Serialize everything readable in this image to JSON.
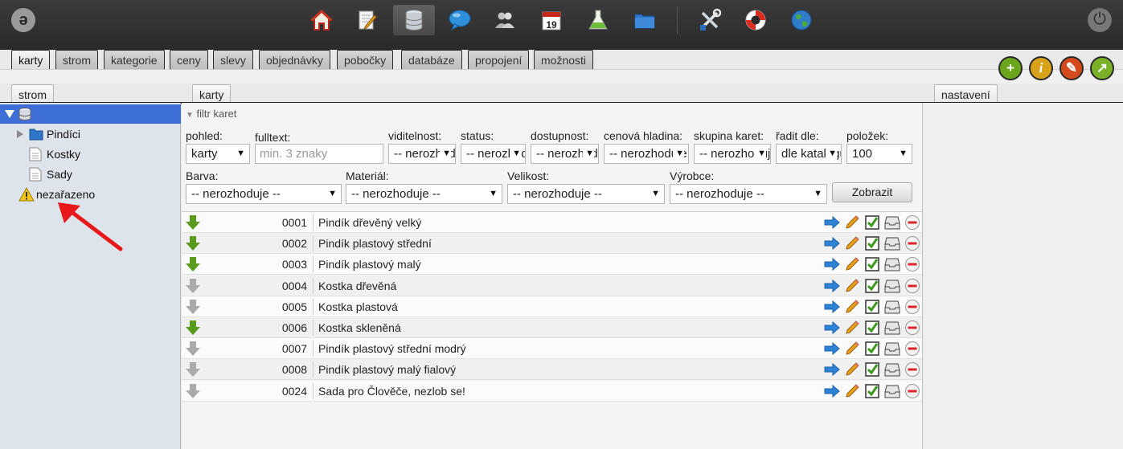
{
  "toolbar": {
    "logo_glyph": "ə",
    "icons": [
      "home-icon",
      "edit-document-icon",
      "database-icon",
      "chat-icon",
      "users-icon",
      "calendar-icon",
      "flask-icon",
      "folder-icon",
      "tools-icon",
      "lifebuoy-icon",
      "globe-icon"
    ],
    "calendar_day": "19",
    "active_icon": "database-icon"
  },
  "main_tabs": [
    "karty",
    "strom",
    "kategorie",
    "ceny",
    "slevy",
    "objednávky",
    "pobočky",
    "databáze",
    "propojení",
    "možnosti"
  ],
  "action_buttons": [
    {
      "name": "add-icon",
      "glyph": "+",
      "color": "#6aa51c"
    },
    {
      "name": "info-icon",
      "glyph": "i",
      "color": "#d9a21b"
    },
    {
      "name": "wrench-icon",
      "glyph": "✎",
      "color": "#d44a1c"
    },
    {
      "name": "export-icon",
      "glyph": "↗",
      "color": "#7bb028"
    }
  ],
  "panels": {
    "left_tab": "strom",
    "center_tab": "karty",
    "right_tab": "nastavení"
  },
  "tree": {
    "items": [
      {
        "label": "Pindíci",
        "type": "folder"
      },
      {
        "label": "Kostky",
        "type": "document"
      },
      {
        "label": "Sady",
        "type": "document"
      },
      {
        "label": "nezařazeno",
        "type": "warning"
      }
    ]
  },
  "filter": {
    "title": "filtr karet",
    "fields": [
      {
        "label": "pohled:",
        "value": "karty"
      },
      {
        "label": "fulltext:",
        "placeholder": "min. 3 znaky"
      },
      {
        "label": "viditelnost:",
        "value": "-- nerozhoduje --"
      },
      {
        "label": "status:",
        "value": "-- nerozhoduje --"
      },
      {
        "label": "dostupnost:",
        "value": "-- nerozhoduje --"
      },
      {
        "label": "cenová hladina:",
        "value": "-- nerozhoduje --"
      },
      {
        "label": "skupina karet:",
        "value": "-- nerozhoduje --"
      },
      {
        "label": "řadit dle:",
        "value": "dle katalogu"
      },
      {
        "label": "položek:",
        "value": "100"
      }
    ],
    "attributes": [
      {
        "label": "Barva:",
        "value": "-- nerozhoduje --"
      },
      {
        "label": "Materiál:",
        "value": "-- nerozhoduje --"
      },
      {
        "label": "Velikost:",
        "value": "-- nerozhoduje --"
      },
      {
        "label": "Výrobce:",
        "value": "-- nerozhoduje --"
      }
    ],
    "submit_label": "Zobrazit"
  },
  "table": {
    "rows": [
      {
        "code": "0001",
        "name": "Pindík dřevěný velký",
        "active": true
      },
      {
        "code": "0002",
        "name": "Pindík plastový střední",
        "active": true
      },
      {
        "code": "0003",
        "name": "Pindík plastový malý",
        "active": true
      },
      {
        "code": "0004",
        "name": "Kostka dřevěná",
        "active": false
      },
      {
        "code": "0005",
        "name": "Kostka plastová",
        "active": false
      },
      {
        "code": "0006",
        "name": "Kostka skleněná",
        "active": true
      },
      {
        "code": "0007",
        "name": "Pindík plastový střední modrý",
        "active": false
      },
      {
        "code": "0008",
        "name": "Pindík plastový malý fialový",
        "active": false
      },
      {
        "code": "0024",
        "name": "Sada pro Člověče, nezlob se!",
        "active": false
      }
    ],
    "row_actions": [
      "forward-icon",
      "pencil-icon",
      "checkbox-icon",
      "archive-icon",
      "remove-icon"
    ]
  },
  "colors": {
    "selection": "#3d6fd6",
    "arrow_active": "#5a9a1e",
    "arrow_inactive": "#aaaaaa",
    "annotation_arrow": "#e8191b"
  }
}
